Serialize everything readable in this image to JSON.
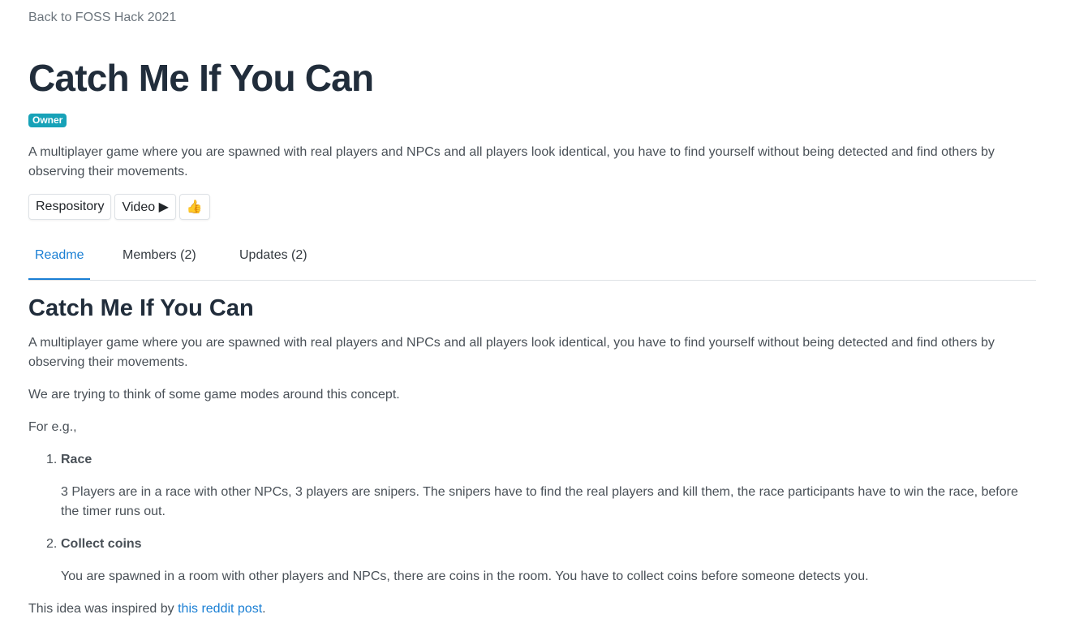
{
  "nav": {
    "back_label": "Back to FOSS Hack 2021"
  },
  "project": {
    "title": "Catch Me If You Can",
    "badge": "Owner",
    "description": "A multiplayer game where you are spawned with real players and NPCs and all players look identical, you have to find yourself without being detected and find others by observing their movements."
  },
  "buttons": {
    "repository": "Respository",
    "video": "Video ▶",
    "like": "👍"
  },
  "tabs": [
    {
      "label": "Readme",
      "active": true
    },
    {
      "label": "Members (2)",
      "active": false
    },
    {
      "label": "Updates (2)",
      "active": false
    }
  ],
  "readme": {
    "title": "Catch Me If You Can",
    "intro": "A multiplayer game where you are spawned with real players and NPCs and all players look identical, you have to find yourself without being detected and find others by observing their movements.",
    "concept": "We are trying to think of some game modes around this concept.",
    "eg": "For e.g.,",
    "modes": [
      {
        "number": "1.",
        "title": "Race",
        "description": "3 Players are in a race with other NPCs, 3 players are snipers. The snipers have to find the real players and kill them, the race participants have to win the race, before the timer runs out."
      },
      {
        "number": "2.",
        "title": "Collect coins",
        "description": "You are spawned in a room with other players and NPCs, there are coins in the room. You have to collect coins before someone detects you."
      }
    ],
    "inspired_prefix": "This idea was inspired by ",
    "inspired_link": "this reddit post",
    "inspired_suffix": "."
  },
  "colors": {
    "accent": "#1a7fd4",
    "badge": "#17a2b8",
    "title": "#212d3b",
    "text": "#495057"
  }
}
